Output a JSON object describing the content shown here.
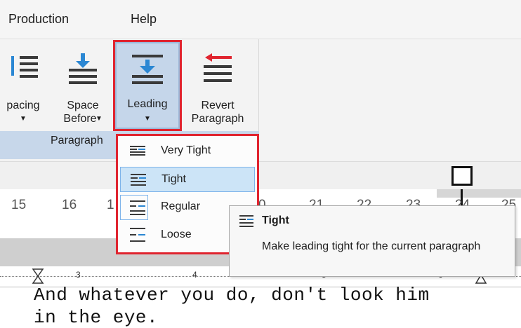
{
  "menubar": {
    "items": [
      "Production",
      "Help"
    ]
  },
  "ribbon": {
    "buttons": {
      "spacing": {
        "label": "pacing",
        "arrow": "▼"
      },
      "space_before": {
        "label_line1": "Space",
        "label_line2": "Before",
        "arrow": "▼"
      },
      "leading": {
        "label": "Leading",
        "arrow": "▼"
      },
      "revert": {
        "label_line1": "Revert",
        "label_line2": "Paragraph"
      }
    },
    "group_label": "Paragraph"
  },
  "dropdown": {
    "items": [
      {
        "label": "Very Tight",
        "icon": "leading-very-tight-icon"
      },
      {
        "label": "Tight",
        "icon": "leading-tight-icon",
        "selected": true
      },
      {
        "label": "Regular",
        "icon": "leading-regular-icon"
      },
      {
        "label": "Loose",
        "icon": "leading-loose-icon"
      }
    ]
  },
  "tooltip": {
    "title": "Tight",
    "description": "Make leading tight for the current paragraph",
    "icon": "leading-tight-icon"
  },
  "ruler_top": {
    "numbers": [
      "15",
      "16",
      "1",
      "0",
      "21",
      "22",
      "23",
      "24",
      "25"
    ]
  },
  "ruler_bottom": {
    "numbers": [
      "3",
      "4",
      "5",
      "6"
    ]
  },
  "document": {
    "line1": "And whatever you do, don't look him",
    "line2": "in the eye."
  },
  "colors": {
    "highlight_red": "#e0242f",
    "selection_blue": "#cce4f7",
    "ribbon_group_band": "#c7d7ea",
    "icon_blue": "#2b87d3",
    "icon_red": "#e0242f",
    "icon_dark": "#3a3a3a"
  }
}
